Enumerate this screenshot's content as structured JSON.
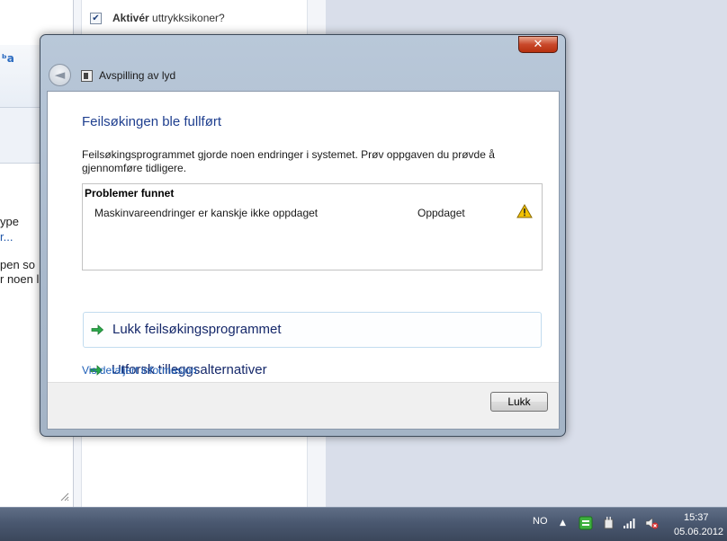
{
  "background": {
    "left_window": {
      "toolbar_icon": "ᵇa",
      "text_lines": [
        "ype",
        "r...",
        "pen so",
        "r noen l"
      ]
    },
    "middle_panel": {
      "checkbox_bold": "Aktivér",
      "checkbox_rest": " uttrykksikoner?",
      "checkbox_checked": true
    }
  },
  "dialog": {
    "close_label": "✕",
    "back_label": "◄",
    "title": "Avspilling av lyd",
    "heading": "Feilsøkingen ble fullført",
    "description": "Feilsøkingsprogrammet gjorde noen endringer i systemet. Prøv oppgaven du prøvde å gjennomføre tidligere.",
    "problems": {
      "header": "Problemer funnet",
      "items": [
        {
          "name": "Maskinvareendringer er kanskje ikke oppdaget",
          "status": "Oppdaget",
          "icon": "warning-icon"
        }
      ]
    },
    "commands": [
      {
        "label": "Lukk feilsøkingsprogrammet",
        "icon": "green-arrow-icon"
      },
      {
        "label": "Utforsk tilleggsalternativer",
        "icon": "green-arrow-icon"
      }
    ],
    "details_link": "Vis detaljert informasjon",
    "close_button": "Lukk"
  },
  "taskbar": {
    "language": "NO",
    "show_hidden": "▲",
    "time": "15:37",
    "date": "05.06.2012"
  },
  "colors": {
    "heading": "#1f3f8f",
    "link": "#1f5fb8",
    "command_text": "#15286a",
    "arrow": "#2aa84a",
    "warning": "#f2c200"
  }
}
